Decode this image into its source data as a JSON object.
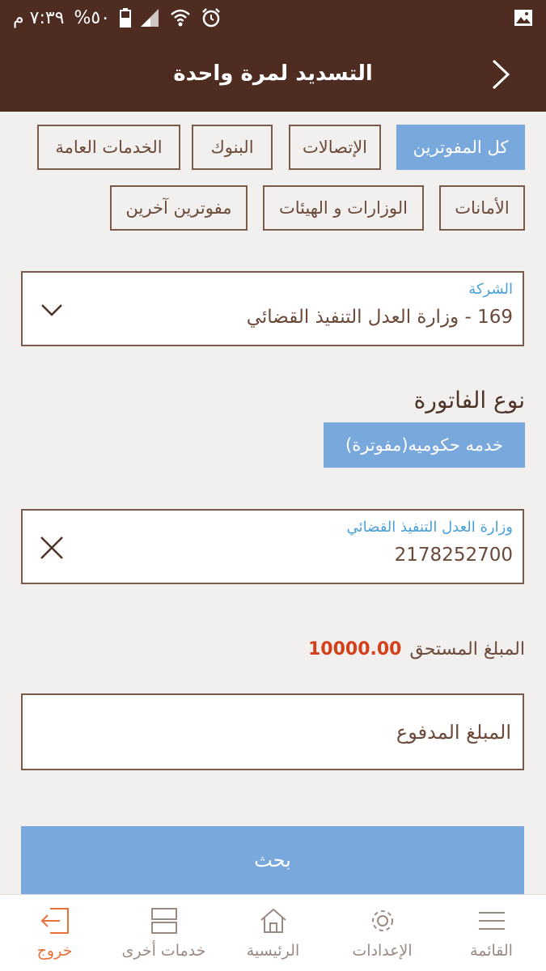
{
  "status_bar": {
    "time": "٧:٣٩ م",
    "battery": "%٥٠",
    "icons": [
      "battery-icon",
      "signal-icon",
      "wifi-icon",
      "alarm-icon",
      "gallery-icon"
    ]
  },
  "header": {
    "title": "التسديد لمرة واحدة",
    "back_icon": "chevron-right-icon"
  },
  "categories": {
    "row1": [
      "كل المفوترين",
      "الإتصالات",
      "البنوك",
      "الخدمات العامة"
    ],
    "row2": [
      "الأمانات",
      "الوزارات و الهيئات",
      "مفوترين آخرين"
    ],
    "active": "كل المفوترين"
  },
  "company_field": {
    "label": "الشركة",
    "value": "169 - وزارة العدل التنفيذ القضائي",
    "icon": "chevron-down-icon"
  },
  "bill_type": {
    "title": "نوع الفاتورة",
    "selected": "خدمه حكوميه(مفوترة)"
  },
  "account_field": {
    "label": "وزارة العدل التنفيذ القضائي",
    "value": "2178252700",
    "icon": "close-icon"
  },
  "due": {
    "label": "المبلغ المستحق",
    "amount": "10000.00"
  },
  "paid": {
    "placeholder": "المبلغ المدفوع"
  },
  "search_button": "بحث",
  "bottom_nav": [
    {
      "label": "القائمة",
      "icon": "menu-icon"
    },
    {
      "label": "الإعدادات",
      "icon": "gear-icon"
    },
    {
      "label": "الرئيسية",
      "icon": "home-icon"
    },
    {
      "label": "خدمات أخرى",
      "icon": "services-icon"
    },
    {
      "label": "خروج",
      "icon": "exit-icon"
    }
  ],
  "colors": {
    "header_bg": "#4e2c22",
    "accent_blue": "#78a8dc",
    "amount_red": "#d4401a",
    "exit_orange": "#e8703a",
    "label_blue": "#4aa0d8"
  }
}
